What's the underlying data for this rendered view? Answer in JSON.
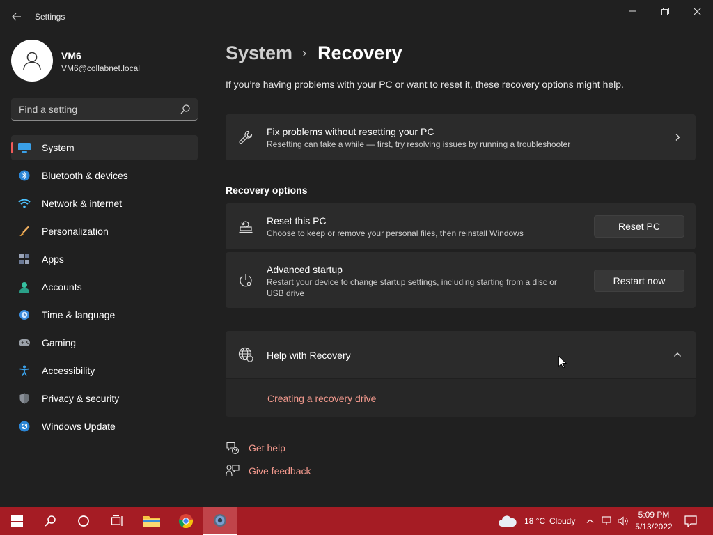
{
  "window": {
    "title": "Settings",
    "controls": [
      "minimize",
      "maximize",
      "close"
    ]
  },
  "profile": {
    "name": "VM6",
    "email": "VM6@collabnet.local"
  },
  "search": {
    "placeholder": "Find a setting"
  },
  "sidebar": {
    "items": [
      {
        "label": "System",
        "icon": "system-icon",
        "active": true
      },
      {
        "label": "Bluetooth & devices",
        "icon": "bluetooth-icon"
      },
      {
        "label": "Network & internet",
        "icon": "wifi-icon"
      },
      {
        "label": "Personalization",
        "icon": "brush-icon"
      },
      {
        "label": "Apps",
        "icon": "apps-icon"
      },
      {
        "label": "Accounts",
        "icon": "accounts-icon"
      },
      {
        "label": "Time & language",
        "icon": "clock-globe-icon"
      },
      {
        "label": "Gaming",
        "icon": "gamepad-icon"
      },
      {
        "label": "Accessibility",
        "icon": "accessibility-icon"
      },
      {
        "label": "Privacy & security",
        "icon": "shield-icon"
      },
      {
        "label": "Windows Update",
        "icon": "update-icon"
      }
    ]
  },
  "breadcrumb": {
    "parent": "System",
    "separator": "›",
    "current": "Recovery"
  },
  "intro": "If you’re having problems with your PC or want to reset it, these recovery options might help.",
  "fix_card": {
    "title": "Fix problems without resetting your PC",
    "subtitle": "Resetting can take a while — first, try resolving issues by running a troubleshooter"
  },
  "recovery_options": {
    "heading": "Recovery options",
    "reset": {
      "title": "Reset this PC",
      "subtitle": "Choose to keep or remove your personal files, then reinstall Windows",
      "button": "Reset PC"
    },
    "advanced": {
      "title": "Advanced startup",
      "subtitle_line1": "Restart your device to change startup settings, including starting from a disc or",
      "subtitle_line2": "USB drive",
      "button": "Restart now"
    }
  },
  "help": {
    "title": "Help with Recovery",
    "expanded": true,
    "link": "Creating a recovery drive"
  },
  "footer": {
    "get_help": "Get help",
    "give_feedback": "Give feedback"
  },
  "taskbar": {
    "weather_temp": "18 °C",
    "weather_desc": "Cloudy",
    "time": "5:09 PM",
    "date": "5/13/2022"
  },
  "colors": {
    "accent_link": "#f49a8e",
    "nav_indicator": "#f05a5a",
    "taskbar": "#a51c24",
    "background": "#202020",
    "card": "#2b2b2b"
  }
}
